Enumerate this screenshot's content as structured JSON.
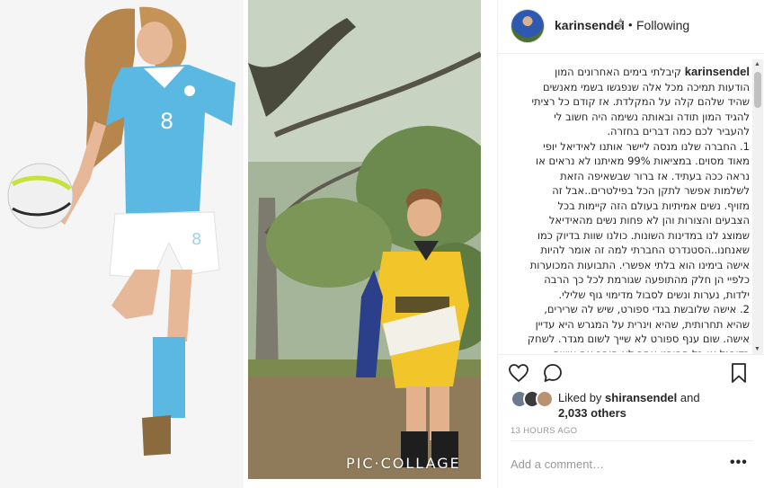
{
  "media": {
    "watermark": "PIC·COLLAGE",
    "left_photo_icon": "footballer-photo",
    "right_photo_icon": "young-player-photo"
  },
  "post": {
    "username": "karinsendel",
    "follow_separator": "•",
    "follow_status": "Following",
    "caption_user": "karinsendel",
    "caption_lines": [
      "קיבלתי בימים האחרונים המון",
      "הודעות תמיכה מכל אלה שנפגשו בשמי מאנשים",
      "שהיד שלהם קלה על המקלדת. אז קודם כל רציתי",
      "להגיד המון תודה ובאותה נשימה היה חשוב לי",
      "להעביר לכם כמה דברים בחזרה.",
      "1. החברה שלנו מנסה ליישר אותנו לאידיאל יופי",
      "מאוד מסוים. במציאות 99% מאיתנו לא נראים או",
      "נראה ככה בעתיד. אז ברור שבשאיפה הזאת",
      "לשלמות אפשר לתקן הכל בפילטרים..אבל זה",
      "מזויף. נשים אמיתיות בעולם הזה קיימות בכל",
      "הצבעים והצורות והן לא פחות נשים מהאידיאל",
      "שמוצג לנו במדינות השונות. כולנו שוות בדיוק כמו",
      "שאנחנו..הסטנדרט החברתי למה זה אומר להיות",
      "אישה בימינו הוא בלתי אפשרי. התבועות המכוערות",
      "כלפיי הן חלק מהתופעה שגורמת לכל כך הרבה",
      "ילדות, נערות ונשים לסבול מדימוי גוף שלילי.",
      "2. אישה שלובשת בגדי ספורט, שיש לה שרירים,",
      "שהיא תחרותית, שהיא וינרית על המגרש היא עדיין",
      "אישה. שום ענף ספורט לא שייך לשום מגדר. לשחק",
      "כדורגל או כל ספורט אחר לא הופך אף אישה"
    ],
    "liked_prefix": "Liked by ",
    "liked_user": "shiransendel",
    "liked_and": " and",
    "liked_others": "2,033 others",
    "timestamp": "13 HOURS AGO",
    "comment_placeholder": "Add a comment…",
    "more_label": "•••"
  },
  "colors": {
    "text": "#262626",
    "muted": "#999999",
    "border": "#efefef",
    "jersey_blue": "#5bb8e3",
    "kit_yellow": "#f2c62b"
  }
}
